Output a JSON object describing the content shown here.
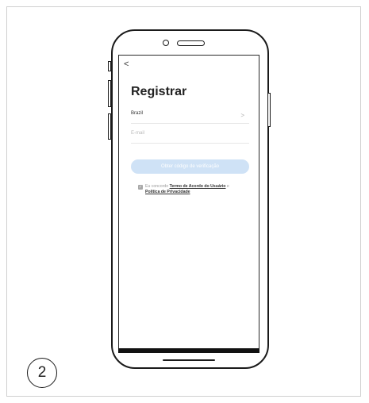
{
  "screen": {
    "back_symbol": "<",
    "title": "Registrar",
    "country": {
      "value": "Brazil",
      "chevron": ">"
    },
    "email": {
      "placeholder": "E-mail"
    },
    "verify_button": "Obter código de verificação",
    "agreement": {
      "check_mark": "✓",
      "prefix": "Eu concordo ",
      "terms_link": "Termo de Acordo do Usuário",
      "middle": " e ",
      "privacy_link": "Política de Privacidade"
    }
  },
  "step": {
    "number": "2"
  },
  "colors": {
    "button_bg": "#cfe2f6",
    "text_dark": "#222222",
    "placeholder": "#b9b9b9"
  }
}
